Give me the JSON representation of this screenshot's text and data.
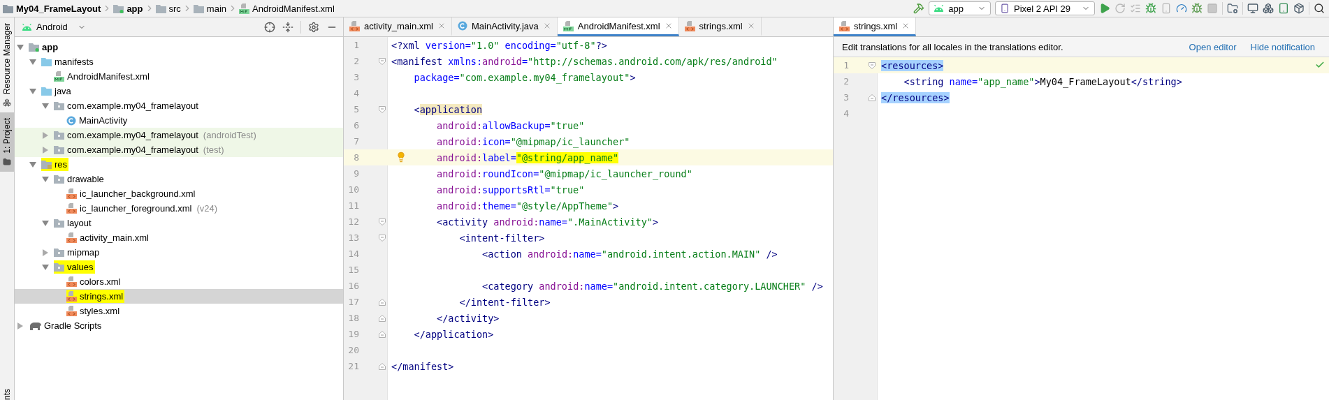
{
  "breadcrumbs": [
    {
      "label": "My04_FrameLayout",
      "kind": "project"
    },
    {
      "label": "app",
      "kind": "module"
    },
    {
      "label": "src",
      "kind": "folder"
    },
    {
      "label": "main",
      "kind": "folder"
    },
    {
      "label": "AndroidManifest.xml",
      "kind": "manifest"
    }
  ],
  "toolbar": {
    "run_config": "app",
    "device": "Pixel 2 API 29"
  },
  "tool_strip": [
    {
      "label": "Resource Manager",
      "selected": false
    },
    {
      "label": "1: Project",
      "selected": true
    }
  ],
  "tool_strip_bottom": "nts",
  "project_panel": {
    "view": "Android",
    "tree": [
      {
        "label": "app",
        "kind": "module",
        "expanded": true,
        "selected": false,
        "highlighted": false,
        "children": [
          {
            "label": "manifests",
            "kind": "source-folder",
            "expanded": true,
            "selected": false,
            "highlighted": false,
            "children": [
              {
                "label": "AndroidManifest.xml",
                "kind": "manifest",
                "selected": false,
                "highlighted": false
              }
            ]
          },
          {
            "label": "java",
            "kind": "source-folder",
            "expanded": true,
            "selected": false,
            "highlighted": false,
            "children": [
              {
                "label": "com.example.my04_framelayout",
                "kind": "package",
                "expanded": true,
                "selected": false,
                "highlighted": false,
                "children": [
                  {
                    "label": "MainActivity",
                    "kind": "class",
                    "selected": false,
                    "highlighted": false
                  }
                ]
              },
              {
                "label": "com.example.my04_framelayout",
                "suffix": "(androidTest)",
                "kind": "test-package",
                "expanded": false,
                "selected": false,
                "highlighted": false
              },
              {
                "label": "com.example.my04_framelayout",
                "suffix": "(test)",
                "kind": "test-package",
                "expanded": false,
                "selected": false,
                "highlighted": false
              }
            ]
          },
          {
            "label": "res",
            "kind": "res-folder",
            "expanded": true,
            "selected": false,
            "highlighted": true,
            "children": [
              {
                "label": "drawable",
                "kind": "package",
                "expanded": true,
                "selected": false,
                "highlighted": false,
                "children": [
                  {
                    "label": "ic_launcher_background.xml",
                    "kind": "xml",
                    "selected": false,
                    "highlighted": false
                  },
                  {
                    "label": "ic_launcher_foreground.xml",
                    "suffix": "(v24)",
                    "kind": "xml",
                    "selected": false,
                    "highlighted": false
                  }
                ]
              },
              {
                "label": "layout",
                "kind": "package",
                "expanded": true,
                "selected": false,
                "highlighted": false,
                "children": [
                  {
                    "label": "activity_main.xml",
                    "kind": "xml",
                    "selected": false,
                    "highlighted": false
                  }
                ]
              },
              {
                "label": "mipmap",
                "kind": "package",
                "expanded": false,
                "selected": false,
                "highlighted": false
              },
              {
                "label": "values",
                "kind": "package",
                "expanded": true,
                "selected": false,
                "highlighted": true,
                "children": [
                  {
                    "label": "colors.xml",
                    "kind": "xml",
                    "selected": false,
                    "highlighted": false
                  },
                  {
                    "label": "strings.xml",
                    "kind": "xml",
                    "selected": true,
                    "highlighted": true
                  },
                  {
                    "label": "styles.xml",
                    "kind": "xml",
                    "selected": false,
                    "highlighted": false
                  }
                ]
              }
            ]
          }
        ]
      },
      {
        "label": "Gradle Scripts",
        "kind": "gradle",
        "expanded": false,
        "selected": false,
        "highlighted": false
      }
    ]
  },
  "editor": {
    "tabs": [
      {
        "label": "activity_main.xml",
        "kind": "xml",
        "selected": false
      },
      {
        "label": "MainActivity.java",
        "kind": "class",
        "selected": false
      },
      {
        "label": "AndroidManifest.xml",
        "kind": "manifest",
        "selected": true
      },
      {
        "label": "strings.xml",
        "kind": "xml",
        "selected": false
      }
    ],
    "lines": [
      {
        "number": "1",
        "kind": "plain",
        "current": false,
        "tokens": [
          {
            "text": "<?xml ",
            "kind": "tag"
          },
          {
            "text": "version=",
            "kind": "attr"
          },
          {
            "text": "\"1.0\"",
            "kind": "value"
          },
          {
            "text": " encoding=",
            "kind": "attr"
          },
          {
            "text": "\"utf-8\"",
            "kind": "value"
          },
          {
            "text": "?>",
            "kind": "tag"
          }
        ]
      },
      {
        "number": "2",
        "kind": "opener",
        "current": false,
        "tokens": [
          {
            "text": "<manifest ",
            "kind": "tag"
          },
          {
            "text": "xmlns:",
            "kind": "attr"
          },
          {
            "text": "android",
            "kind": "ns"
          },
          {
            "text": "=",
            "kind": "attr"
          },
          {
            "text": "\"http://schemas.android.com/apk/res/android\"",
            "kind": "value"
          }
        ]
      },
      {
        "number": "3",
        "kind": "plain",
        "current": false,
        "tokens": [
          {
            "text": "    package=",
            "kind": "attr"
          },
          {
            "text": "\"com.example.my04_framelayout\"",
            "kind": "value"
          },
          {
            "text": ">",
            "kind": "tag"
          }
        ]
      },
      {
        "number": "4",
        "kind": "plain",
        "current": false
      },
      {
        "number": "5",
        "kind": "opener",
        "current": false,
        "tokens": [
          {
            "text": "    <",
            "kind": "tag"
          },
          {
            "text": "application",
            "kind": "tag",
            "matched": true
          }
        ]
      },
      {
        "number": "6",
        "kind": "plain",
        "current": false,
        "tokens": [
          {
            "text": "        android:",
            "kind": "ns"
          },
          {
            "text": "allowBackup=",
            "kind": "attr"
          },
          {
            "text": "\"true\"",
            "kind": "value"
          }
        ]
      },
      {
        "number": "7",
        "kind": "plain",
        "current": false,
        "tokens": [
          {
            "text": "        android:",
            "kind": "ns"
          },
          {
            "text": "icon=",
            "kind": "attr"
          },
          {
            "text": "\"@mipmap/ic_launcher\"",
            "kind": "value"
          }
        ]
      },
      {
        "number": "8",
        "kind": "plain",
        "current": true,
        "lightbulb": true,
        "tokens": [
          {
            "text": "        android:",
            "kind": "ns"
          },
          {
            "text": "label=",
            "kind": "attr"
          },
          {
            "text": "\"@string/app_name\"",
            "kind": "value",
            "marked": true
          }
        ]
      },
      {
        "number": "9",
        "kind": "plain",
        "current": false,
        "tokens": [
          {
            "text": "        android:",
            "kind": "ns"
          },
          {
            "text": "roundIcon=",
            "kind": "attr"
          },
          {
            "text": "\"@mipmap/ic_launcher_round\"",
            "kind": "value"
          }
        ]
      },
      {
        "number": "10",
        "kind": "plain",
        "current": false,
        "tokens": [
          {
            "text": "        android:",
            "kind": "ns"
          },
          {
            "text": "supportsRtl=",
            "kind": "attr"
          },
          {
            "text": "\"true\"",
            "kind": "value"
          }
        ]
      },
      {
        "number": "11",
        "kind": "plain",
        "current": false,
        "tokens": [
          {
            "text": "        android:",
            "kind": "ns"
          },
          {
            "text": "theme=",
            "kind": "attr"
          },
          {
            "text": "\"@style/AppTheme\"",
            "kind": "value"
          },
          {
            "text": ">",
            "kind": "tag"
          }
        ]
      },
      {
        "number": "12",
        "kind": "opener",
        "current": false,
        "tokens": [
          {
            "text": "        <activity ",
            "kind": "tag"
          },
          {
            "text": "android:",
            "kind": "ns"
          },
          {
            "text": "name=",
            "kind": "attr"
          },
          {
            "text": "\".MainActivity\"",
            "kind": "value"
          },
          {
            "text": ">",
            "kind": "tag"
          }
        ]
      },
      {
        "number": "13",
        "kind": "opener",
        "current": false,
        "tokens": [
          {
            "text": "            <intent-filter>",
            "kind": "tag"
          }
        ]
      },
      {
        "number": "14",
        "kind": "plain",
        "current": false,
        "tokens": [
          {
            "text": "                <action ",
            "kind": "tag"
          },
          {
            "text": "android:",
            "kind": "ns"
          },
          {
            "text": "name=",
            "kind": "attr"
          },
          {
            "text": "\"android.intent.action.MAIN\"",
            "kind": "value"
          },
          {
            "text": " />",
            "kind": "tag"
          }
        ]
      },
      {
        "number": "15",
        "kind": "plain",
        "current": false
      },
      {
        "number": "16",
        "kind": "plain",
        "current": false,
        "tokens": [
          {
            "text": "                <category ",
            "kind": "tag"
          },
          {
            "text": "android:",
            "kind": "ns"
          },
          {
            "text": "name=",
            "kind": "attr"
          },
          {
            "text": "\"android.intent.category.LAUNCHER\"",
            "kind": "value"
          },
          {
            "text": " />",
            "kind": "tag"
          }
        ]
      },
      {
        "number": "17",
        "kind": "closer",
        "current": false,
        "tokens": [
          {
            "text": "            </intent-filter>",
            "kind": "tag"
          }
        ]
      },
      {
        "number": "18",
        "kind": "closer",
        "current": false,
        "tokens": [
          {
            "text": "        </activity>",
            "kind": "tag"
          }
        ]
      },
      {
        "number": "19",
        "kind": "closer",
        "current": false,
        "tokens": [
          {
            "text": "    </application>",
            "kind": "tag"
          }
        ]
      },
      {
        "number": "20",
        "kind": "plain",
        "current": false
      },
      {
        "number": "21",
        "kind": "closer",
        "current": false,
        "tokens": [
          {
            "text": "</manifest>",
            "kind": "tag"
          }
        ]
      }
    ]
  },
  "side_editor": {
    "tabs": [
      {
        "label": "strings.xml",
        "kind": "xml",
        "selected": true
      }
    ],
    "notification": {
      "message": "Edit translations for all locales in the translations editor.",
      "actions": [
        "Open editor",
        "Hide notification"
      ]
    },
    "lines": [
      {
        "number": "1",
        "kind": "opener",
        "current": true,
        "tokens": [
          {
            "text": "<resources>",
            "kind": "tag",
            "selected": true
          }
        ]
      },
      {
        "number": "2",
        "kind": "plain",
        "current": false,
        "tokens": [
          {
            "text": "    <string ",
            "kind": "tag"
          },
          {
            "text": "name=",
            "kind": "attr"
          },
          {
            "text": "\"app_name\"",
            "kind": "value"
          },
          {
            "text": ">",
            "kind": "tag"
          },
          {
            "text": "My04_FrameLayout",
            "kind": "plain"
          },
          {
            "text": "</string>",
            "kind": "tag"
          }
        ]
      },
      {
        "number": "3",
        "kind": "closer",
        "current": false,
        "tokens": [
          {
            "text": "</resources>",
            "kind": "tag",
            "selected": true
          }
        ]
      },
      {
        "number": "4",
        "kind": "plain",
        "current": false
      }
    ]
  }
}
